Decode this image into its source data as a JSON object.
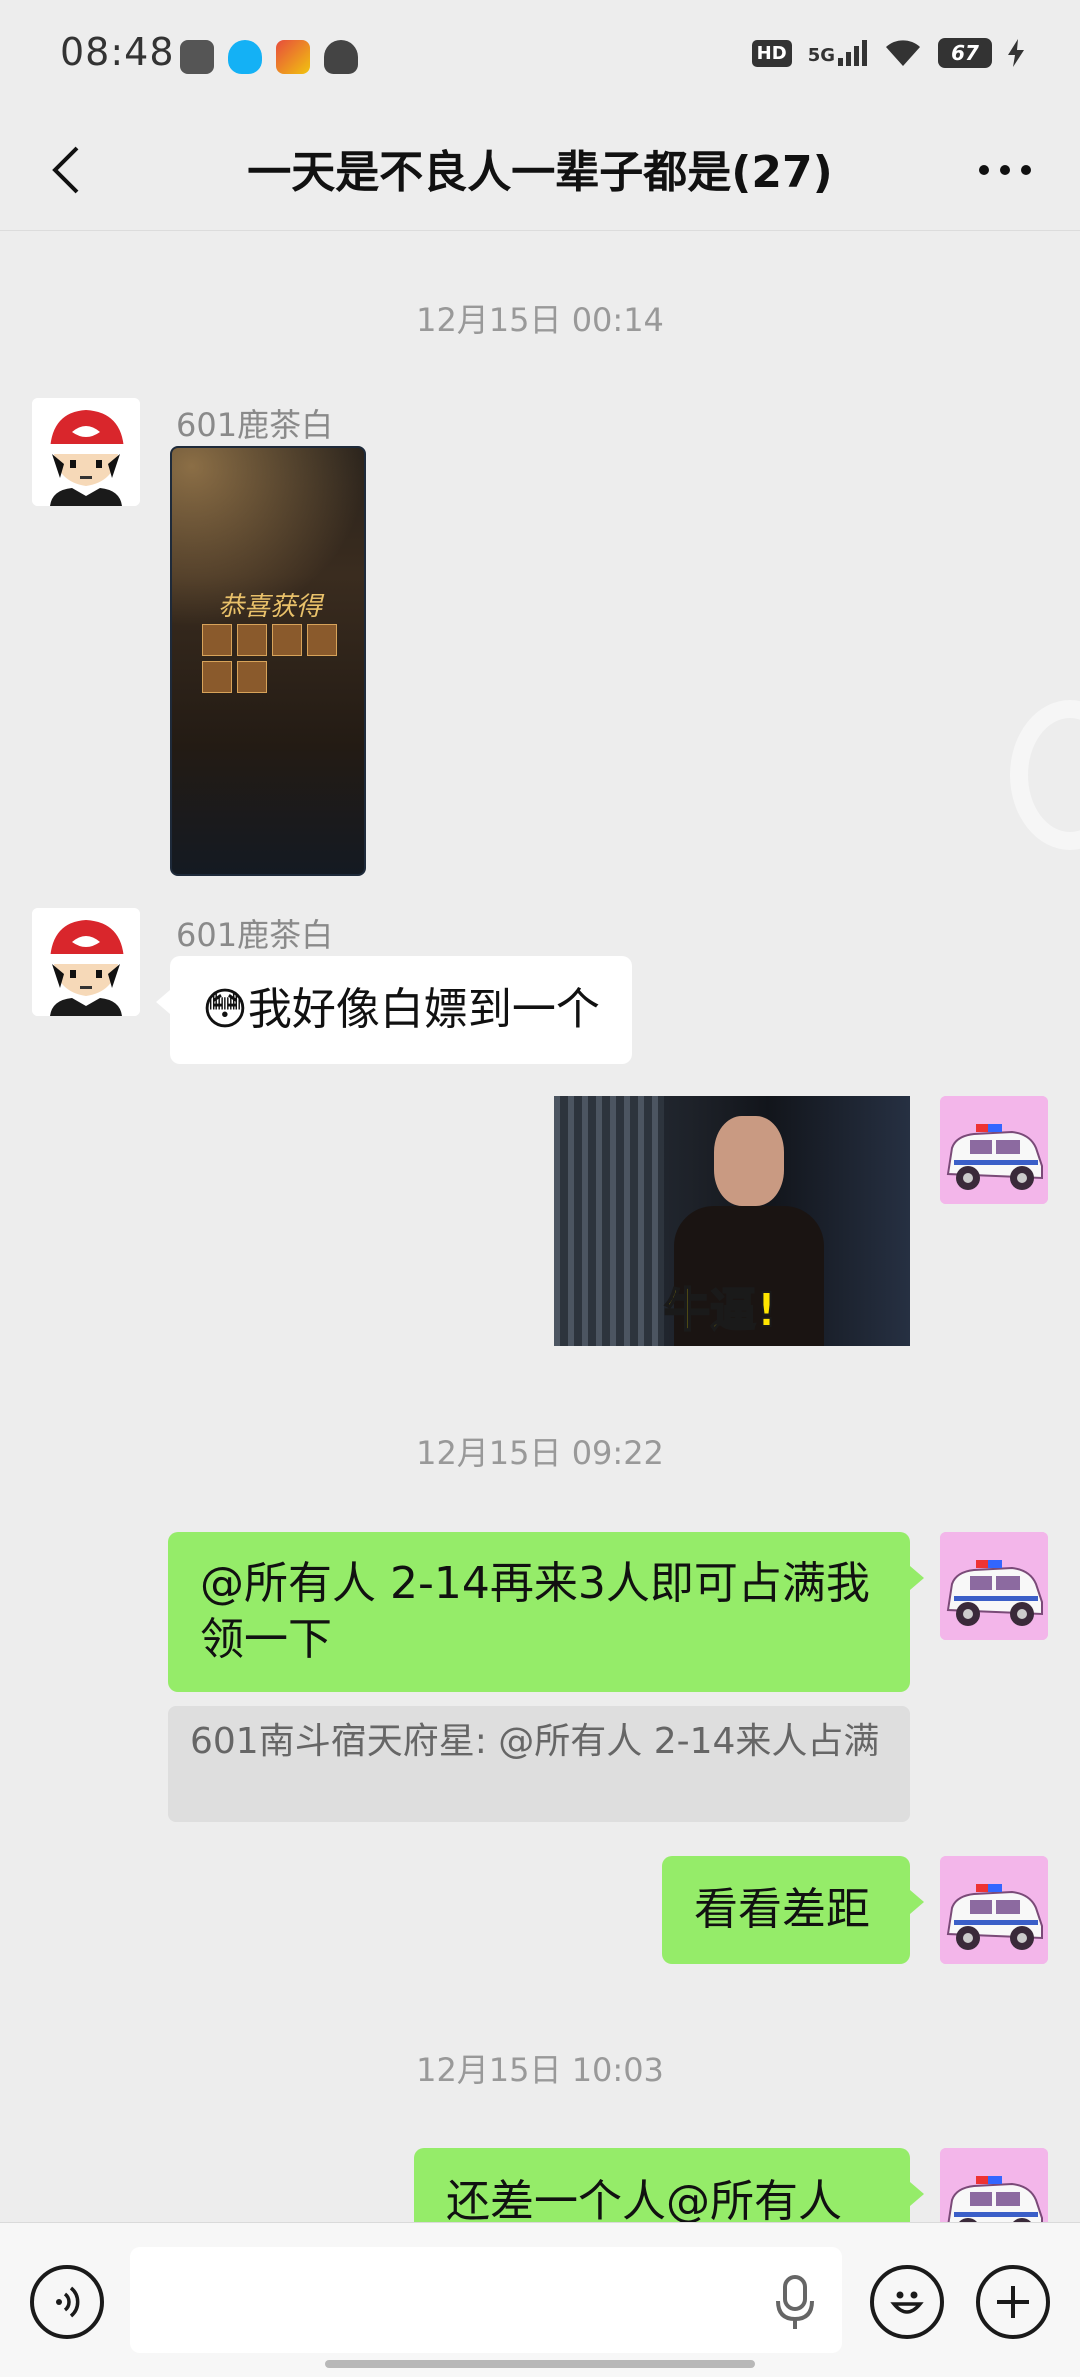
{
  "status_bar": {
    "time": "08:48",
    "hd": "HD",
    "network": "5G",
    "battery": "67"
  },
  "header": {
    "title": "一天是不良人一辈子都是(27)",
    "back_icon": "chevron-left-icon",
    "more_icon": "more-dots-icon"
  },
  "timestamps": [
    "12月15日 00:14",
    "12月15日 09:22",
    "12月15日 10:03"
  ],
  "messages": [
    {
      "sender": "601鹿茶白",
      "type": "image",
      "image_caption": "恭喜获得"
    },
    {
      "sender": "601鹿茶白",
      "type": "text",
      "emoji": "😳",
      "text": "我好像白嫖到一个"
    },
    {
      "side": "self",
      "type": "image",
      "image_caption": "牛逼!"
    },
    {
      "side": "self",
      "type": "text",
      "text": "@所有人 2-14再来3人即可占满我领一下"
    },
    {
      "type": "quote",
      "text": "601南斗宿天府星: @所有人 2-14来人占满"
    },
    {
      "side": "self",
      "type": "text",
      "text": "看看差距"
    },
    {
      "side": "self",
      "type": "text",
      "text": "还差一个人@所有人"
    }
  ],
  "input_bar": {
    "voice_icon": "voice-icon",
    "mic_icon": "microphone-icon",
    "emoji_icon": "emoji-icon",
    "plus_icon": "plus-icon",
    "input_value": ""
  },
  "colors": {
    "background": "#ededed",
    "self_bubble": "#95ec69",
    "other_bubble": "#ffffff"
  }
}
